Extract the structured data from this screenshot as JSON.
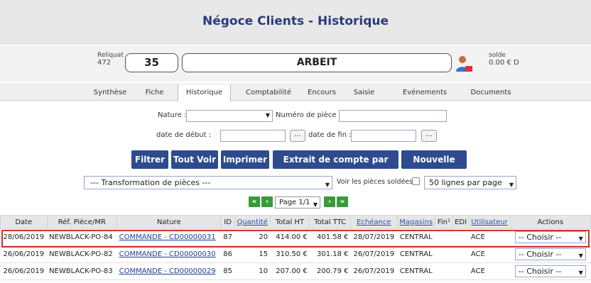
{
  "header": {
    "title": "Négoce Clients - Historique"
  },
  "client": {
    "reliquat_label": "Reliquat",
    "reliquat_value": "472",
    "number": "35",
    "name": "ARBEIT",
    "solde_label": "solde",
    "solde_value": "0.00 € D"
  },
  "tabs": [
    "Synthèse",
    "Fiche",
    "Historique",
    "Comptabilité",
    "Encours",
    "Saisie",
    "Evénements",
    "Documents"
  ],
  "filters": {
    "nature_label": "Nature :",
    "nature_value": "",
    "numero_label": "Numéro de pièce :",
    "numero_value": "",
    "date_debut_label": "date de début :",
    "date_fin_label": "date de fin :",
    "dots": "..."
  },
  "buttons": {
    "filtrer": "Filtrer",
    "tout_voir": "Tout Voir",
    "imprimer": "Imprimer",
    "extrait": "Extrait de compte par email",
    "nouvelle_note": "Nouvelle Note"
  },
  "transformation": {
    "value": "--- Transformation de pièces ---"
  },
  "voir_soldees_label": "Voir les pièces soldées",
  "per_page": {
    "value": "50 lignes par page"
  },
  "pager": {
    "page": "Page 1/1"
  },
  "table": {
    "headers": [
      "Date",
      "Réf. Pièce/MR",
      "Nature",
      "ID",
      "Quantité",
      "Total HT",
      "Total TTC",
      "Echéance",
      "Magasins",
      "Fin¹",
      "EDI",
      "Utilisateur",
      "Actions"
    ],
    "rows": [
      {
        "date": "28/06/2019",
        "ref": "NEWBLACK-PO-84",
        "nature": "COMMANDE - CD00000031",
        "id": "87",
        "qty": "20",
        "ht": "414.00 €",
        "ttc": "401.58 €",
        "echeance": "28/07/2019",
        "magasin": "CENTRAL",
        "fin": "",
        "edi": "",
        "user": "ACE",
        "action": "-- Choisir --"
      },
      {
        "date": "26/06/2019",
        "ref": "NEWBLACK-PO-82",
        "nature": "COMMANDE - CD00000030",
        "id": "86",
        "qty": "15",
        "ht": "310.50 €",
        "ttc": "301.18 €",
        "echeance": "26/07/2019",
        "magasin": "CENTRAL",
        "fin": "",
        "edi": "",
        "user": "ACE",
        "action": "-- Choisir --"
      },
      {
        "date": "26/06/2019",
        "ref": "NEWBLACK-PO-83",
        "nature": "COMMANDE - CD00000029",
        "id": "85",
        "qty": "10",
        "ht": "207.00 €",
        "ttc": "200.79 €",
        "echeance": "26/07/2019",
        "magasin": "CENTRAL",
        "fin": "",
        "edi": "",
        "user": "ACE",
        "action": "-- Choisir --"
      }
    ]
  },
  "colors": {
    "primary": "#2f4b8f",
    "title": "#2a3a7c",
    "pager": "#3a9a3a",
    "highlight": "#d0312d"
  }
}
